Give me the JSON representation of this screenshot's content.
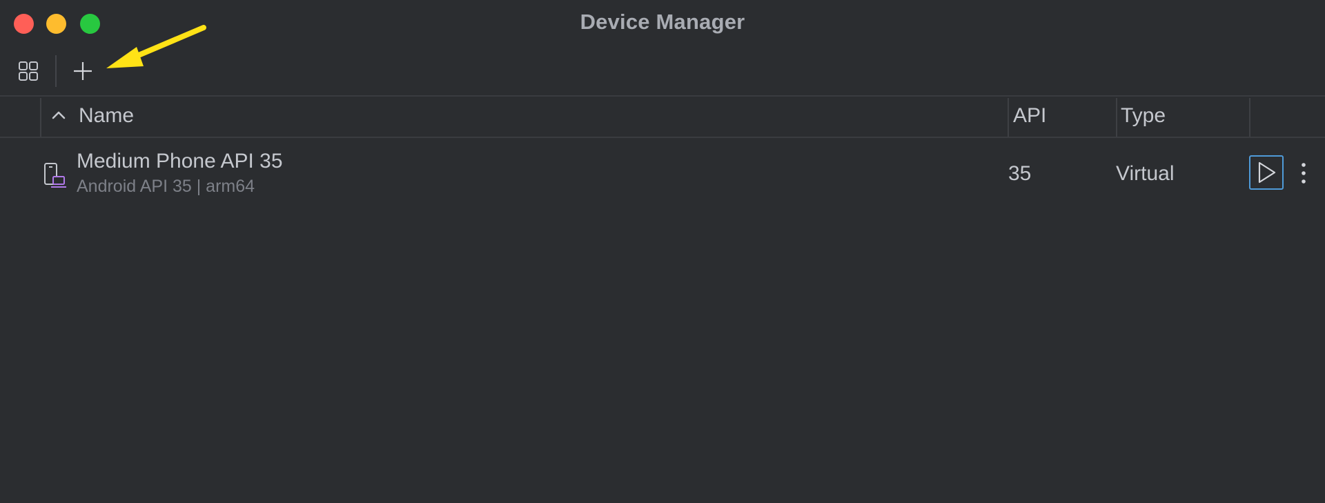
{
  "window": {
    "title": "Device Manager"
  },
  "toolbar": {
    "buttons": [
      {
        "name": "device-grid",
        "icon": "grid-icon"
      },
      {
        "name": "add-device",
        "icon": "plus-icon"
      }
    ]
  },
  "table": {
    "columns": [
      "Name",
      "API",
      "Type"
    ],
    "sort": {
      "column": "Name",
      "direction": "ascending"
    },
    "rows": [
      {
        "name": "Medium Phone API 35",
        "subtitle": "Android API 35 | arm64",
        "api": "35",
        "type": "Virtual",
        "icon": "virtual-device-icon",
        "actions": [
          "play-icon",
          "more-vertical-icon"
        ]
      }
    ]
  },
  "colors": {
    "background": "#2b2d30",
    "accent_focus": "#4f9bd9",
    "device_icon_accent": "#b179ea",
    "annotation_arrow": "#ffe216"
  }
}
